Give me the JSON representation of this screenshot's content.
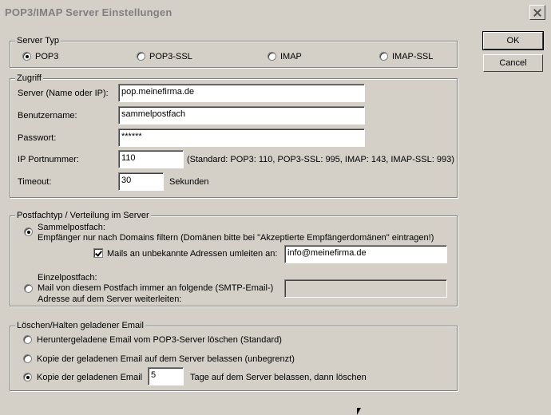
{
  "window": {
    "title": "POP3/IMAP Server Einstellungen"
  },
  "buttons": {
    "ok": "OK",
    "cancel": "Cancel"
  },
  "server_type": {
    "legend": "Server Typ",
    "options": [
      "POP3",
      "POP3-SSL",
      "IMAP",
      "IMAP-SSL"
    ],
    "selected": "POP3"
  },
  "access": {
    "legend": "Zugriff",
    "server_label": "Server (Name oder IP):",
    "server_value": "pop.meinefirma.de",
    "user_label": "Benutzername:",
    "user_value": "sammelpostfach",
    "password_label": "Passwort:",
    "password_value": "******",
    "port_label": "IP Portnummer:",
    "port_value": "110",
    "port_hint": "(Standard: POP3: 110, POP3-SSL: 995, IMAP: 143, IMAP-SSL: 993)",
    "timeout_label": "Timeout:",
    "timeout_value": "30",
    "timeout_unit": "Sekunden"
  },
  "mailbox": {
    "legend": "Postfachtyp / Verteilung im Server",
    "collect_title": "Sammelpostfach:",
    "collect_desc": "Empfänger nur nach Domains filtern (Domänen bitte bei \"Akzeptierte Empfängerdomänen\" eintragen!)",
    "redirect_label": "Mails an unbekannte Adressen umleiten an:",
    "redirect_value": "info@meinefirma.de",
    "redirect_checked": true,
    "single_title": "Einzelpostfach:",
    "single_desc_1": "Mail von diesem Postfach immer an folgende (SMTP-Email-)",
    "single_desc_2": "Adresse auf dem Server weiterleiten:",
    "single_value": "",
    "selected": "Sammelpostfach"
  },
  "delete": {
    "legend": "Löschen/Halten geladener Email",
    "opt1": "Heruntergeladene Email vom POP3-Server löschen (Standard)",
    "opt2": "Kopie der geladenen Email auf dem Server belassen (unbegrenzt)",
    "opt3_prefix": "Kopie der geladenen Email",
    "opt3_days": "5",
    "opt3_suffix": "Tage auf dem Server belassen, dann löschen",
    "selected": 3
  }
}
